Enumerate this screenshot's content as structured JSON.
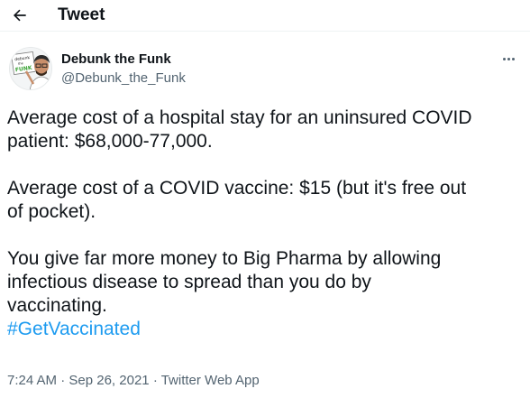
{
  "header": {
    "title": "Tweet",
    "back_icon": "arrow-left-icon"
  },
  "author": {
    "display_name": "Debunk the Funk",
    "handle": "@Debunk_the_Funk",
    "avatar_sign_text": "debunk the FUNK",
    "more_icon": "more-horizontal-icon"
  },
  "tweet": {
    "paragraph1_line1": "Average cost of a hospital stay for an uninsured COVID",
    "paragraph1_line2": "patient: $68,000-77,000.",
    "paragraph2_line1": "Average cost of a COVID vaccine: $15 (but it's free out",
    "paragraph2_line2": "of pocket).",
    "paragraph3_line1": "You give far more money to Big Pharma by allowing",
    "paragraph3_line2": "infectious disease to spread than you do by",
    "paragraph3_line3": "vaccinating.",
    "hashtag": "#GetVaccinated"
  },
  "meta": {
    "time": "7:24 AM",
    "separator": "·",
    "date": "Sep 26, 2021",
    "source": "Twitter Web App"
  },
  "colors": {
    "text": "#0f1419",
    "secondary": "#536471",
    "link": "#1d9bf0",
    "avatar_sign_green": "#3aa335"
  }
}
